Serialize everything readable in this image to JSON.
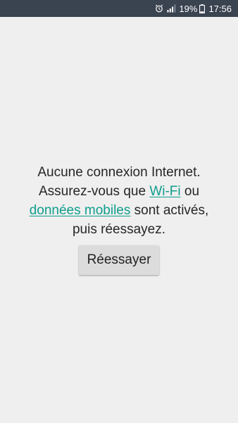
{
  "status_bar": {
    "icons": [
      "alarm-icon",
      "signal-icon",
      "battery-icon"
    ],
    "battery_percent": "19%",
    "time": "17:56"
  },
  "message": {
    "line1": "Aucune connexion Internet.",
    "line2_prefix": "Assurez-vous que ",
    "wifi_link": "Wi-Fi",
    "line2_suffix": " ou",
    "mobile_data_link": "données mobiles",
    "line3_suffix": " sont activés,",
    "line4": "puis réessayez."
  },
  "retry_button": {
    "label": "Réessayer"
  },
  "colors": {
    "status_bar_bg": "#3a4350",
    "background": "#efefef",
    "link": "#0f9d8c",
    "button_bg": "#dcdcdc"
  }
}
